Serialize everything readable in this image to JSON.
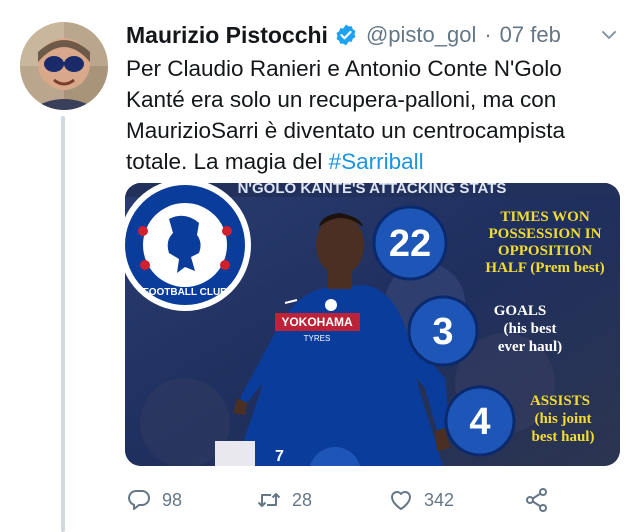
{
  "tweet": {
    "author_name": "Maurizio Pistocchi",
    "handle": "@pisto_gol",
    "date_separator": "·",
    "date": "07 feb",
    "text_lines": [
      "Per Claudio Ranieri e Antonio Conte N'Golo",
      "Kanté era solo un recupera-palloni, ma con",
      "MaurizioSarri è diventato un centrocampista"
    ],
    "text_last_prefix": "totale. La magia del ",
    "hashtag": "#Sarriball"
  },
  "media": {
    "banner": "N'GOLO KANTE'S ATTACKING STATS",
    "badge_text": "FOOTBALL CLUB",
    "shirt_sponsor": "YOKOHAMA",
    "shirt_sponsor_sub": "TYRES",
    "shirt_number": "7",
    "stats": [
      {
        "value": "22",
        "label_lines": [
          "TIMES WON",
          "POSSESSION IN",
          "OPPOSITION",
          "HALF (Prem best)"
        ],
        "label_color": "#f3dc32"
      },
      {
        "value": "3",
        "label_lines": [
          "GOALS",
          "(his best",
          "ever haul)"
        ],
        "label_color": "#ffffff"
      },
      {
        "value": "4",
        "label_lines": [
          "ASSISTS",
          "(his joint",
          "best haul)"
        ],
        "label_color": "#f3dc32"
      }
    ]
  },
  "actions": {
    "reply_count": "98",
    "retweet_count": "28",
    "like_count": "342"
  },
  "colors": {
    "link": "#1b95e0",
    "muted": "#657786",
    "chelsea_blue": "#0a3c9c",
    "stat_gold": "#f3dc32"
  },
  "icons": [
    "verified-badge-icon",
    "chevron-down-icon",
    "reply-icon",
    "retweet-icon",
    "like-icon",
    "share-icon"
  ]
}
